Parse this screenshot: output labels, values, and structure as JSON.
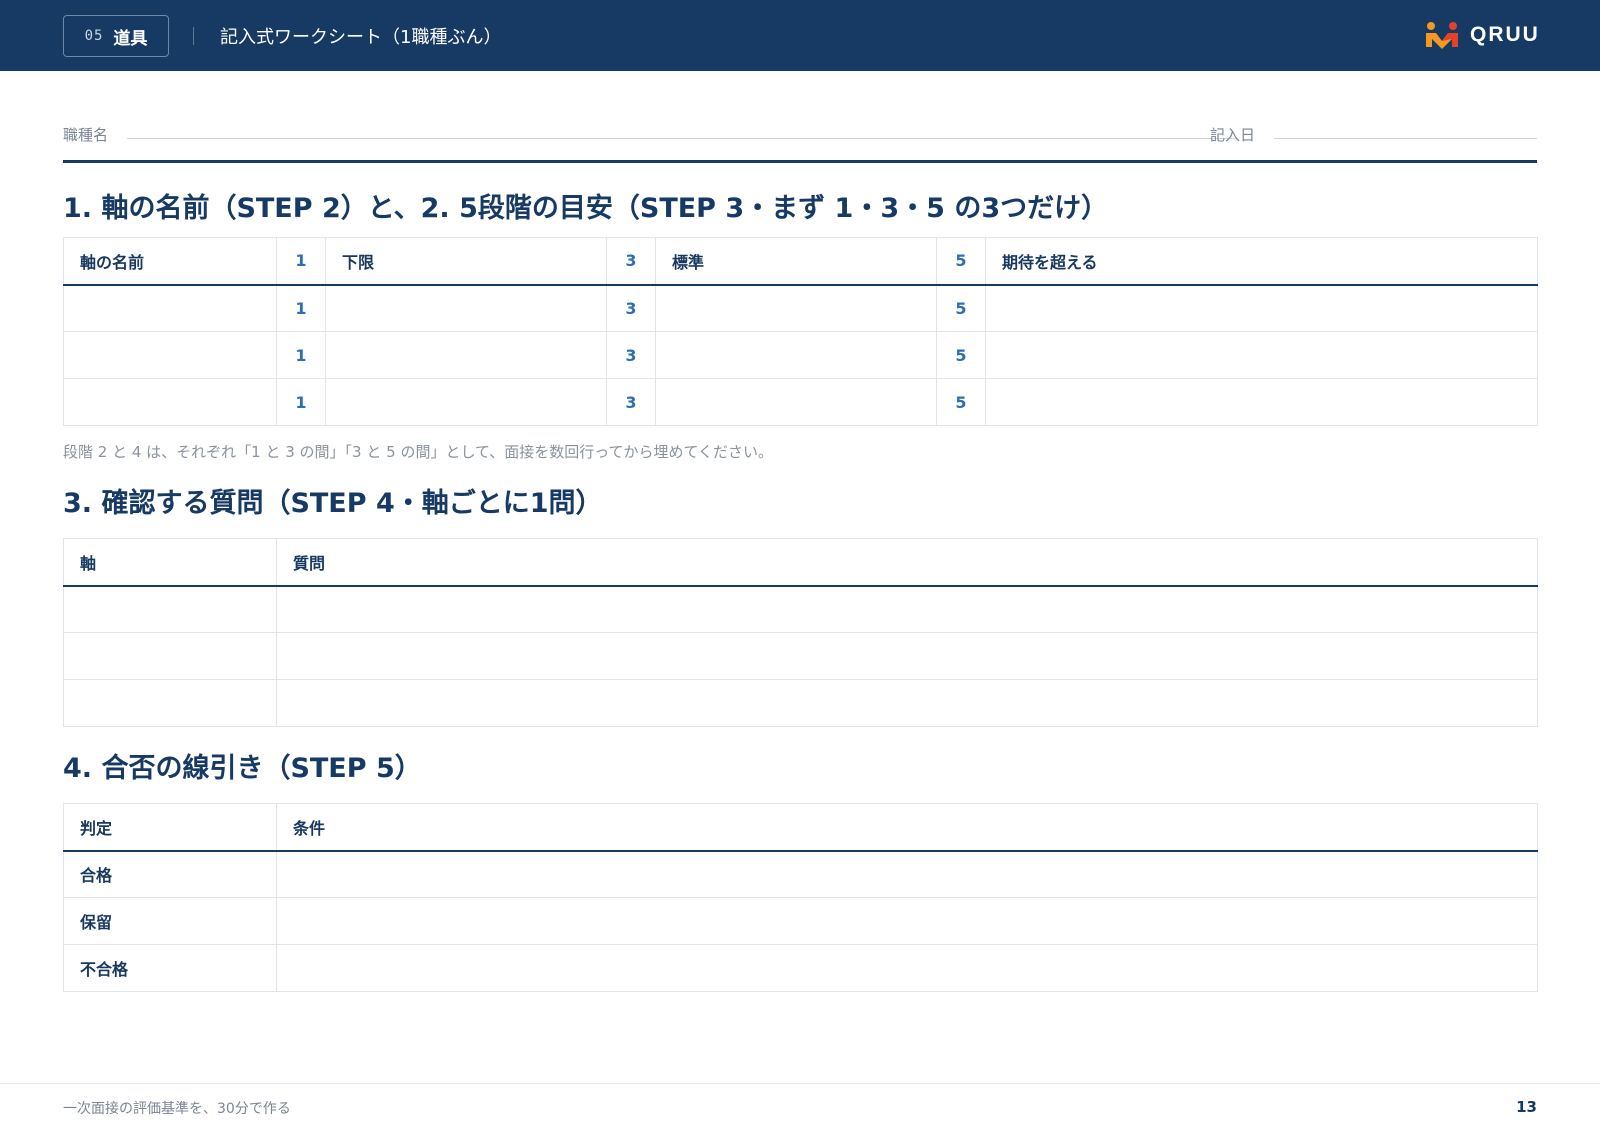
{
  "header": {
    "chip_number": "05",
    "chip_label": "道具",
    "title": "記入式ワークシート（1職種ぶん）",
    "logo_text": "QRUU",
    "logo_icon": "people-logo-icon",
    "background": "#163a63"
  },
  "meta": {
    "job_label": "職種名",
    "date_label": "記入日"
  },
  "section1": {
    "title": "1. 軸の名前（STEP 2）と、2. 5段階の目安（STEP 3・まず 1・3・5 の3つだけ）",
    "headers": {
      "axis": "軸の名前",
      "lvl1": "1",
      "lvl1_label": "下限",
      "lvl3": "3",
      "lvl3_label": "標準",
      "lvl5": "5",
      "lvl5_label": "期待を超える"
    },
    "rows": [
      {
        "l1": "1",
        "l3": "3",
        "l5": "5"
      },
      {
        "l1": "1",
        "l3": "3",
        "l5": "5"
      },
      {
        "l1": "1",
        "l3": "3",
        "l5": "5"
      }
    ],
    "note": "段階 2 と 4 は、それぞれ「1 と 3 の間」「3 と 5 の間」として、面接を数回行ってから埋めてください。"
  },
  "section2": {
    "title": "3. 確認する質問（STEP 4・軸ごとに1問）",
    "headers": {
      "axis": "軸",
      "question": "質問"
    }
  },
  "section3": {
    "title": "4. 合否の線引き（STEP 5）",
    "headers": {
      "verdict": "判定",
      "condition": "条件"
    },
    "rows": [
      {
        "label": "合格"
      },
      {
        "label": "保留"
      },
      {
        "label": "不合格"
      }
    ]
  },
  "footer": {
    "text": "一次面接の評価基準を、30分で作る",
    "page": "13"
  },
  "colors": {
    "navy": "#163a63",
    "level_blue": "#2a6fb8",
    "logo_orange": "#f39a1e",
    "logo_red": "#e8412b"
  }
}
